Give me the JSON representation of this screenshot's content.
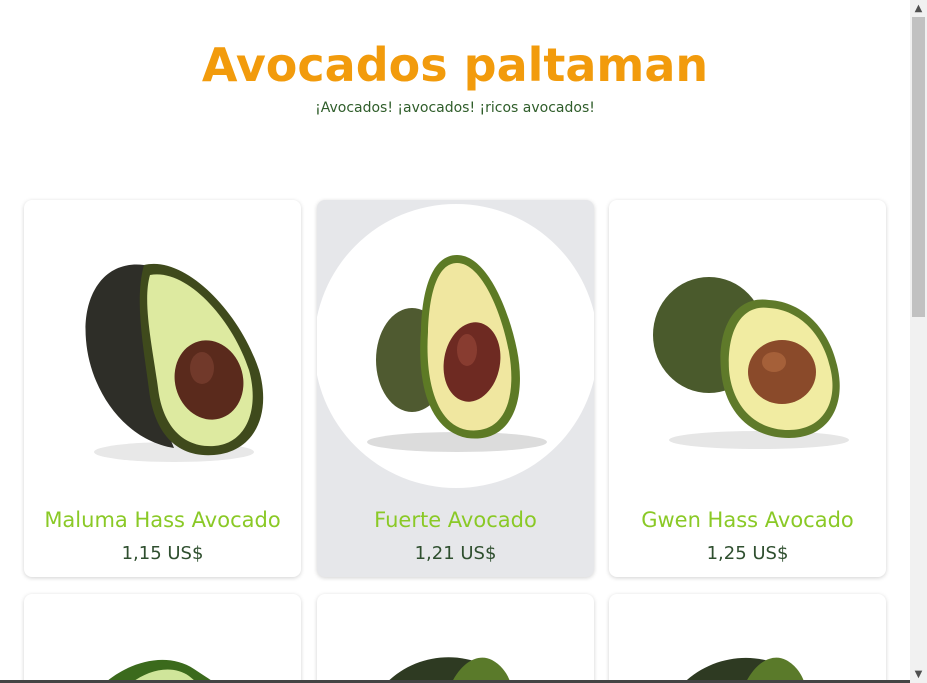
{
  "header": {
    "title": "Avocados paltaman",
    "subtitle": "¡Avocados! ¡avocados! ¡ricos avocados!"
  },
  "products": [
    {
      "name": "Maluma Hass Avocado",
      "price": "1,15 US$"
    },
    {
      "name": "Fuerte Avocado",
      "price": "1,21 US$"
    },
    {
      "name": "Gwen Hass Avocado",
      "price": "1,25 US$"
    }
  ],
  "colors": {
    "title": "#f29b0c",
    "product_name": "#8ac926",
    "price": "#2f4f2f",
    "hover_card": "#e6e7ea"
  }
}
